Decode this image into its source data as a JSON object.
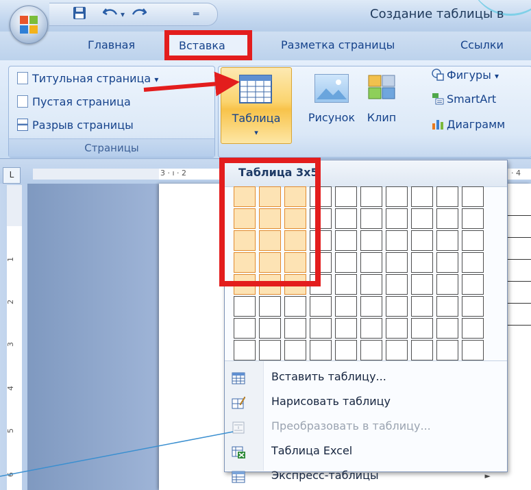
{
  "window": {
    "title": "Создание таблицы в"
  },
  "qat": {
    "save_icon": "save-icon",
    "undo_icon": "undo-icon",
    "redo_icon": "redo-icon",
    "customize_icon": "qat-customize-icon"
  },
  "tabs": [
    {
      "label": "Главная"
    },
    {
      "label": "Вставка"
    },
    {
      "label": "Разметка страницы"
    },
    {
      "label": "Ссылки"
    }
  ],
  "ribbon": {
    "pages_group": {
      "label": "Страницы",
      "items": [
        {
          "label": "Титульная страница",
          "dropdown": "▾"
        },
        {
          "label": "Пустая страница"
        },
        {
          "label": "Разрыв страницы"
        }
      ]
    },
    "table_button": {
      "label": "Таблица",
      "arrow": "▾"
    },
    "picture_button": {
      "label": "Рисунок"
    },
    "clip_button": {
      "label": "Клип"
    },
    "shapes_button": {
      "label": "Фигуры",
      "arrow": "▾"
    },
    "smartart_button": {
      "label": "SmartArt"
    },
    "chart_button": {
      "label": "Диаграмм"
    }
  },
  "ruler": {
    "top_marks": [
      "3 · ı · 2",
      "· 4"
    ],
    "left_marks": [
      "1",
      "2",
      "3",
      "4",
      "5",
      "6"
    ]
  },
  "dropdown": {
    "header": "Таблица 3x5",
    "grid": {
      "columns": 10,
      "rows": 8,
      "selected_columns": 3,
      "selected_rows": 5
    },
    "menu": [
      {
        "label": "Вставить таблицу...",
        "icon": "insert-table-icon",
        "enabled": true
      },
      {
        "label": "Нарисовать таблицу",
        "icon": "draw-table-icon",
        "enabled": true
      },
      {
        "label": "Преобразовать в таблицу...",
        "icon": "convert-to-table-icon",
        "enabled": false
      },
      {
        "label": "Таблица Excel",
        "icon": "excel-table-icon",
        "enabled": true
      },
      {
        "label": "Экспресс-таблицы",
        "icon": "quick-tables-icon",
        "enabled": true,
        "submenu": "►"
      }
    ]
  },
  "colors": {
    "annotation_red": "#e31d1d",
    "highlight_fill": "#fde3b4",
    "highlight_border": "#e28a2d",
    "ribbon_text": "#15428b",
    "annotation_line": "#3a8fd0"
  }
}
